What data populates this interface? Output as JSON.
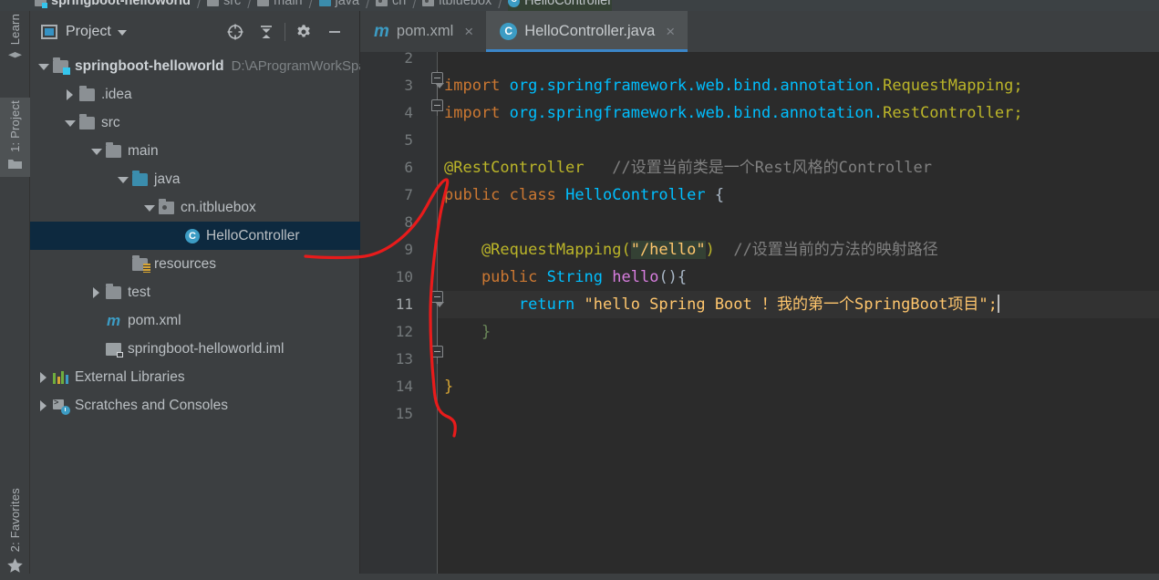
{
  "breadcrumb": {
    "items": [
      {
        "label": "springboot-helloworld",
        "icon": "module-folder-icon",
        "bold": true
      },
      {
        "label": "src",
        "icon": "folder-icon"
      },
      {
        "label": "main",
        "icon": "folder-icon"
      },
      {
        "label": "java",
        "icon": "source-folder-icon"
      },
      {
        "label": "cn",
        "icon": "package-icon"
      },
      {
        "label": "itbluebox",
        "icon": "package-icon"
      },
      {
        "label": "HelloController",
        "icon": "class-icon"
      }
    ],
    "separator": "/"
  },
  "tool_strip": {
    "items": [
      {
        "label": "Learn",
        "icon": "graduation-cap-icon",
        "active": false
      },
      {
        "label": "1: Project",
        "icon": "folder-icon",
        "active": true
      },
      {
        "label": "2: Favorites",
        "icon": "star-icon",
        "active": false
      }
    ]
  },
  "panel": {
    "title": "Project",
    "view_icon": "project-view-icon",
    "caret_icon": "chevron-down-icon",
    "tools": [
      {
        "name": "locate-icon",
        "title": "Select Opened File"
      },
      {
        "name": "collapse-all-icon",
        "title": "Collapse All"
      },
      {
        "name": "gear-icon",
        "title": "Settings"
      },
      {
        "name": "hide-icon",
        "title": "Hide"
      }
    ]
  },
  "tree": {
    "rows": [
      {
        "label": "springboot-helloworld",
        "path": "D:\\AProgramWorkSpace\\idea\\springboot-helloworld",
        "indent": 0,
        "arrow": "down",
        "icon": "module-folder-icon",
        "bold": true,
        "selected": false
      },
      {
        "label": ".idea",
        "path": "",
        "indent": 1,
        "arrow": "right",
        "icon": "folder-icon",
        "bold": false,
        "selected": false
      },
      {
        "label": "src",
        "path": "",
        "indent": 1,
        "arrow": "down",
        "icon": "folder-icon",
        "bold": false,
        "selected": false
      },
      {
        "label": "main",
        "path": "",
        "indent": 2,
        "arrow": "down",
        "icon": "folder-icon",
        "bold": false,
        "selected": false
      },
      {
        "label": "java",
        "path": "",
        "indent": 3,
        "arrow": "down",
        "icon": "source-folder-icon",
        "bold": false,
        "selected": false
      },
      {
        "label": "cn.itbluebox",
        "path": "",
        "indent": 4,
        "arrow": "down",
        "icon": "package-icon",
        "bold": false,
        "selected": false
      },
      {
        "label": "HelloController",
        "path": "",
        "indent": 5,
        "arrow": "none",
        "icon": "class-icon",
        "bold": false,
        "selected": true
      },
      {
        "label": "resources",
        "path": "",
        "indent": 3,
        "arrow": "none",
        "icon": "resources-folder-icon",
        "bold": false,
        "selected": false
      },
      {
        "label": "test",
        "path": "",
        "indent": 2,
        "arrow": "right",
        "icon": "folder-icon",
        "bold": false,
        "selected": false
      },
      {
        "label": "pom.xml",
        "path": "",
        "indent": 2,
        "arrow": "none",
        "icon": "maven-icon",
        "bold": false,
        "selected": false
      },
      {
        "label": "springboot-helloworld.iml",
        "path": "",
        "indent": 2,
        "arrow": "none",
        "icon": "iml-file-icon",
        "bold": false,
        "selected": false
      },
      {
        "label": "External Libraries",
        "path": "",
        "indent": 0,
        "arrow": "right",
        "icon": "library-icon",
        "bold": false,
        "selected": false
      },
      {
        "label": "Scratches and Consoles",
        "path": "",
        "indent": 0,
        "arrow": "right",
        "icon": "scratches-icon",
        "bold": false,
        "selected": false
      }
    ]
  },
  "tabs": [
    {
      "label": "pom.xml",
      "icon": "maven-icon",
      "active": false,
      "close": "×"
    },
    {
      "label": "HelloController.java",
      "icon": "class-icon",
      "active": true,
      "close": "×"
    }
  ],
  "editor": {
    "current_line": 11,
    "first_line_number": 2,
    "line_numbers": [
      2,
      3,
      4,
      5,
      6,
      7,
      8,
      9,
      10,
      11,
      12,
      13,
      14,
      15
    ],
    "lines": [
      {
        "n": 2,
        "tokens": []
      },
      {
        "n": 3,
        "tokens": [
          {
            "t": "import ",
            "c": "kw"
          },
          {
            "t": "org.springframework.web.bind.annotation",
            "c": "kw2"
          },
          {
            "t": ".",
            "c": "kw2"
          },
          {
            "t": "RequestMapping",
            "c": "ann"
          },
          {
            "t": ";",
            "c": "ann"
          }
        ]
      },
      {
        "n": 4,
        "tokens": [
          {
            "t": "import ",
            "c": "kw"
          },
          {
            "t": "org.springframework.web.bind.annotation",
            "c": "kw2"
          },
          {
            "t": ".",
            "c": "kw2"
          },
          {
            "t": "RestController",
            "c": "ann"
          },
          {
            "t": ";",
            "c": "ann"
          }
        ]
      },
      {
        "n": 5,
        "tokens": []
      },
      {
        "n": 6,
        "tokens": [
          {
            "t": "@RestController",
            "c": "ann"
          },
          {
            "t": "   ",
            "c": "plain"
          },
          {
            "t": "//设置当前类是一个Rest风格的Controller",
            "c": "cmt"
          }
        ]
      },
      {
        "n": 7,
        "tokens": [
          {
            "t": "public ",
            "c": "kw"
          },
          {
            "t": "class ",
            "c": "kw"
          },
          {
            "t": "HelloController",
            "c": "kw2"
          },
          {
            "t": " {",
            "c": "brace"
          }
        ]
      },
      {
        "n": 8,
        "tokens": []
      },
      {
        "n": 9,
        "tokens": [
          {
            "t": "    @RequestMapping(",
            "c": "ann"
          },
          {
            "t": "\"/hello\"",
            "c": "str sel"
          },
          {
            "t": ")",
            "c": "ann"
          },
          {
            "t": "  ",
            "c": "plain"
          },
          {
            "t": "//设置当前的方法的映射路径",
            "c": "cmt"
          }
        ]
      },
      {
        "n": 10,
        "tokens": [
          {
            "t": "    public ",
            "c": "kw"
          },
          {
            "t": "String ",
            "c": "kw2"
          },
          {
            "t": "hello",
            "c": "mthv"
          },
          {
            "t": "(){",
            "c": "brace"
          }
        ]
      },
      {
        "n": 11,
        "tokens": [
          {
            "t": "        return ",
            "c": "kw2"
          },
          {
            "t": "\"hello Spring Boot ！我的第一个SpringBoot项目\"",
            "c": "str"
          },
          {
            "t": ";",
            "c": "mth"
          }
        ]
      },
      {
        "n": 12,
        "tokens": [
          {
            "t": "    }",
            "c": "brace-green"
          }
        ]
      },
      {
        "n": 13,
        "tokens": []
      },
      {
        "n": 14,
        "tokens": [
          {
            "t": "}",
            "c": "brace-yellow"
          }
        ]
      },
      {
        "n": 15,
        "tokens": []
      }
    ]
  },
  "annotation": {
    "color": "#e81b1b",
    "description": "hand-drawn red arc linking HelloController tree node to the code block"
  },
  "colors": {
    "background": "#3c3f41",
    "editor_bg": "#2b2b2b",
    "gutter_bg": "#313335",
    "selection": "#0d293f",
    "accent": "#3b86c9",
    "keyword": "#cc7832",
    "string": "#ffc66d",
    "comment": "#808080",
    "annotation_color": "#bbb529",
    "type": "#00bfff"
  }
}
